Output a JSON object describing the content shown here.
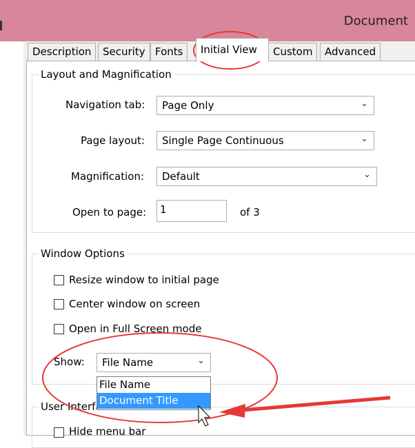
{
  "window": {
    "title": "Document"
  },
  "tabs": [
    {
      "label": "Description"
    },
    {
      "label": "Security"
    },
    {
      "label": "Fonts"
    },
    {
      "label": "Initial View"
    },
    {
      "label": "Custom"
    },
    {
      "label": "Advanced"
    }
  ],
  "layout_group": {
    "title": "Layout and Magnification",
    "navigation_tab": {
      "label": "Navigation tab:",
      "value": "Page Only"
    },
    "page_layout": {
      "label": "Page layout:",
      "value": "Single Page Continuous"
    },
    "magnification": {
      "label": "Magnification:",
      "value": "Default"
    },
    "open_to_page": {
      "label": "Open to page:",
      "value": "1",
      "suffix": "of 3"
    }
  },
  "window_options": {
    "title": "Window Options",
    "resize": {
      "label": "Resize window to initial page",
      "checked": false
    },
    "center": {
      "label": "Center window on screen",
      "checked": false
    },
    "fullscreen": {
      "label": "Open in Full Screen mode",
      "checked": false
    },
    "show": {
      "label": "Show:",
      "value": "File Name",
      "options": [
        "File Name",
        "Document Title"
      ],
      "highlighted": "Document Title"
    }
  },
  "user_interface": {
    "title": "User Interface",
    "hide_menu_bar": {
      "label": "Hide menu bar",
      "checked": false
    }
  },
  "annotation_colors": {
    "circle": "#e53935",
    "arrow": "#e53935"
  }
}
